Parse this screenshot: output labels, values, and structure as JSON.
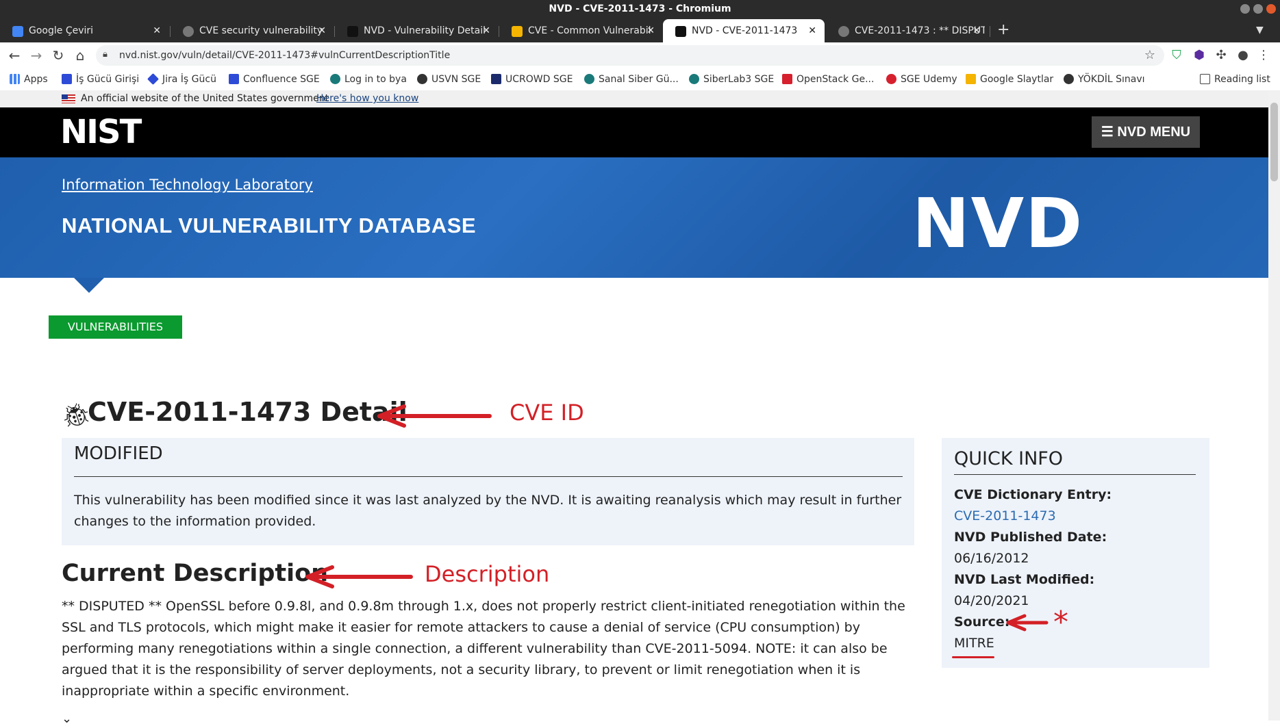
{
  "window": {
    "title": "NVD - CVE-2011-1473 - Chromium"
  },
  "tabs": [
    {
      "label": "Google Çeviri",
      "favicon_color": "#4285f4"
    },
    {
      "label": "CVE security vulnerability",
      "favicon_color": "#777777"
    },
    {
      "label": "NVD - Vulnerability Detail",
      "favicon_color": "#111111"
    },
    {
      "label": "CVE - Common Vulnerabil",
      "favicon_color": "#f4b400"
    },
    {
      "label": "NVD - CVE-2011-1473",
      "favicon_color": "#111111"
    },
    {
      "label": "CVE-2011-1473 : ** DISPUT",
      "favicon_color": "#777777"
    }
  ],
  "toolbar": {
    "url": "nvd.nist.gov/vuln/detail/CVE-2011-1473#vulnCurrentDescriptionTitle",
    "back_icon": "arrow-left-icon",
    "forward_icon": "arrow-right-icon",
    "reload_icon": "reload-icon",
    "home_icon": "home-icon"
  },
  "bookmarks": [
    {
      "label": "Apps",
      "color": "#4285f4"
    },
    {
      "label": "İş Gücü Girişi",
      "color": "#2d4bd6"
    },
    {
      "label": "Jira İş Gücü",
      "color": "#2d4bd6"
    },
    {
      "label": "Confluence SGE",
      "color": "#2d4bd6"
    },
    {
      "label": "Log in to bya",
      "color": "#1a7a7a"
    },
    {
      "label": "USVN SGE",
      "color": "#333333"
    },
    {
      "label": "UCROWD SGE",
      "color": "#1b2a6b"
    },
    {
      "label": "Sanal Siber Gü...",
      "color": "#1a7a7a"
    },
    {
      "label": "SiberLab3 SGE",
      "color": "#1a7a7a"
    },
    {
      "label": "OpenStack Ge...",
      "color": "#d6202e"
    },
    {
      "label": "SGE Udemy",
      "color": "#d6202e"
    },
    {
      "label": "Google Slaytlar",
      "color": "#f4b400"
    },
    {
      "label": "YÖKDİL Sınavı",
      "color": "#333333"
    }
  ],
  "reading_list": "Reading list",
  "gov_banner": {
    "text": "An official website of the United States government",
    "link": "Here's how you know"
  },
  "header": {
    "logo": "NIST",
    "menu_label": "NVD MENU",
    "lab_link": "Information Technology Laboratory",
    "db_title": "NATIONAL VULNERABILITY DATABASE",
    "nvd_logo": "NVD"
  },
  "nav": {
    "vulnerabilities": "VULNERABILITIES"
  },
  "detail": {
    "title": "CVE-2011-1473 Detail",
    "modified_title": "MODIFIED",
    "modified_text": "This vulnerability has been modified since it was last analyzed by the NVD. It is awaiting reanalysis which may result in further changes to the information provided.",
    "current_description_title": "Current Description",
    "description": "** DISPUTED ** OpenSSL before 0.9.8l, and 0.9.8m through 1.x, does not properly restrict client-initiated renegotiation within the SSL and TLS protocols, which might make it easier for remote attackers to cause a denial of service (CPU consumption) by performing many renegotiations within a single connection, a different vulnerability than CVE-2011-5094. NOTE: it can also be argued that it is the responsibility of server deployments, not a security library, to prevent or limit renegotiation when it is inappropriate within a specific environment."
  },
  "annotations": {
    "cve_id": "CVE ID",
    "description": "Description",
    "star": "*",
    "color": "#d32026"
  },
  "quick_info": {
    "title": "QUICK INFO",
    "cve_entry_label": "CVE Dictionary Entry:",
    "cve_entry_value": "CVE-2011-1473",
    "published_label": "NVD Published Date:",
    "published_value": "06/16/2012",
    "modified_label": "NVD Last Modified:",
    "modified_value": "04/20/2021",
    "source_label": "Source:",
    "source_value": "MITRE"
  }
}
